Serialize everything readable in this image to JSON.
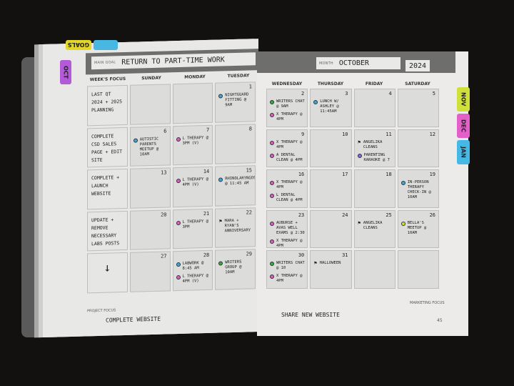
{
  "tabs": {
    "top_left": {
      "label": "GOALS",
      "color": "#e3d62b"
    },
    "top_left_2": {
      "color": "#49b8e0"
    },
    "current": {
      "label": "OCT",
      "color": "#b25ad8"
    },
    "right": [
      {
        "label": "NOV",
        "color": "#cfe03a"
      },
      {
        "label": "DEC",
        "color": "#e260c8"
      },
      {
        "label": "JAN",
        "color": "#45b8e6"
      }
    ]
  },
  "header": {
    "main_goal_label": "MAIN GOAL",
    "main_goal": "RETURN TO PART-TIME WORK",
    "month_label": "MONTH",
    "month": "OCTOBER",
    "year": "2024"
  },
  "columns_left": [
    "WEEK'S FOCUS",
    "SUNDAY",
    "MONDAY",
    "TUESDAY"
  ],
  "columns_right": [
    "WEDNESDAY",
    "THURSDAY",
    "FRIDAY",
    "SATURDAY"
  ],
  "dot_colors": {
    "blue": "#3aa8e0",
    "pink": "#e05cc0",
    "green": "#2fae3f",
    "purple": "#8a63e0",
    "yellow": "#d8e02a"
  },
  "weeks": [
    {
      "focus": "LAST QT 2024 + 2025 PLANNING",
      "days": [
        {
          "num": "",
          "events": []
        },
        {
          "num": "",
          "events": []
        },
        {
          "num": "1",
          "events": [
            {
              "mark": "blue",
              "text": "NIGHTGUARD FITTING @ 9AM"
            }
          ]
        },
        {
          "num": "2",
          "events": [
            {
              "mark": "green",
              "text": "WRITERS CHAT @ 9AM"
            },
            {
              "mark": "pink",
              "text": "X THERAPY @ 4PM"
            }
          ]
        },
        {
          "num": "3",
          "events": [
            {
              "mark": "blue",
              "text": "LUNCH W/ ASHLEY @ 11:45AM"
            }
          ]
        },
        {
          "num": "4",
          "events": []
        },
        {
          "num": "5",
          "events": []
        }
      ]
    },
    {
      "focus": "COMPLETE CSD SALES PAGE + EDIT SITE",
      "days": [
        {
          "num": "6",
          "events": [
            {
              "mark": "blue",
              "text": "AUTISTIC PARENTS MEETUP @ 10AM"
            }
          ]
        },
        {
          "num": "7",
          "events": [
            {
              "mark": "pink",
              "text": "L THERAPY @ 3PM (V)"
            }
          ]
        },
        {
          "num": "8",
          "events": []
        },
        {
          "num": "9",
          "events": [
            {
              "mark": "pink",
              "text": "X THERAPY @ 4PM"
            },
            {
              "mark": "pink",
              "text": "A DENTAL CLEAN @ 4PM"
            }
          ]
        },
        {
          "num": "10",
          "events": []
        },
        {
          "num": "11",
          "events": [
            {
              "mark": "flag",
              "text": "ANGELIKA CLEANS"
            },
            {
              "mark": "purple",
              "text": "PARENTING KARAOKE @ 7"
            }
          ]
        },
        {
          "num": "12",
          "events": []
        }
      ]
    },
    {
      "focus": "COMPLETE + LAUNCH WEBSITE",
      "days": [
        {
          "num": "13",
          "events": []
        },
        {
          "num": "14",
          "events": [
            {
              "mark": "pink",
              "text": "L THERAPY @ 4PM (V)"
            }
          ]
        },
        {
          "num": "15",
          "events": [
            {
              "mark": "blue",
              "text": "RHINOLARYNGOSCOPY @ 11:45 AM"
            }
          ]
        },
        {
          "num": "16",
          "events": [
            {
              "mark": "pink",
              "text": "X THERAPY @ 4PM"
            },
            {
              "mark": "pink",
              "text": "L DENTAL CLEAN @ 4PM"
            }
          ]
        },
        {
          "num": "17",
          "events": []
        },
        {
          "num": "18",
          "events": []
        },
        {
          "num": "19",
          "events": [
            {
              "mark": "blue",
              "text": "IN-PERSON THERAPY CHECK-IN @ 10AM"
            }
          ]
        }
      ]
    },
    {
      "focus": "UPDATE + REMOVE NECESSARY LABS POSTS",
      "days": [
        {
          "num": "20",
          "events": []
        },
        {
          "num": "21",
          "events": [
            {
              "mark": "pink",
              "text": "L THERAPY @ 3PM"
            }
          ]
        },
        {
          "num": "22",
          "events": [
            {
              "mark": "flag",
              "text": "MARA + RYAN'S ANNIVERSARY"
            }
          ]
        },
        {
          "num": "23",
          "events": [
            {
              "mark": "pink",
              "text": "AUBURSE + AVAS WELL EXAMS @ 2:30"
            },
            {
              "mark": "pink",
              "text": "X THERAPY @ 4PM"
            }
          ]
        },
        {
          "num": "24",
          "events": []
        },
        {
          "num": "25",
          "events": [
            {
              "mark": "flag",
              "text": "ANGELIKA CLEANS"
            }
          ]
        },
        {
          "num": "26",
          "events": [
            {
              "mark": "yellow",
              "text": "BELLA'S MEETUP @ 10AM"
            }
          ]
        }
      ]
    },
    {
      "focus": "↓",
      "days": [
        {
          "num": "27",
          "events": []
        },
        {
          "num": "28",
          "events": [
            {
              "mark": "blue",
              "text": "LABWORK @ 8:45 AM"
            },
            {
              "mark": "pink",
              "text": "L THERAPY @ 4PM (V)"
            }
          ]
        },
        {
          "num": "29",
          "events": [
            {
              "mark": "green",
              "text": "WRITERS GROUP @ 10AM"
            }
          ]
        },
        {
          "num": "30",
          "events": [
            {
              "mark": "green",
              "text": "WRITERS CHAT @ 10"
            },
            {
              "mark": "pink",
              "text": "X THERAPY @ 4PM"
            }
          ]
        },
        {
          "num": "31",
          "events": [
            {
              "mark": "flag",
              "text": "HALLOWEEN"
            }
          ]
        },
        {
          "num": "",
          "events": []
        },
        {
          "num": "",
          "events": []
        }
      ]
    }
  ],
  "footer": {
    "project_focus_label": "PROJECT FOCUS",
    "project_focus": "COMPLETE WEBSITE",
    "marketing_focus_label": "MARKETING FOCUS",
    "marketing_focus": "SHARE NEW WEBSITE",
    "page_number": "45"
  }
}
